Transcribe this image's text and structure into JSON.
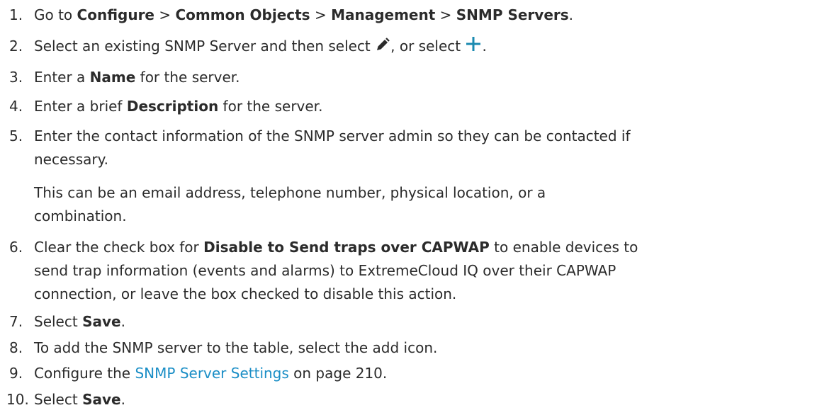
{
  "steps": [
    {
      "num": "1.",
      "parts": {
        "a": "Go to ",
        "b": "Configure",
        "c": " > ",
        "d": "Common Objects",
        "e": " > ",
        "f": "Management",
        "g": " > ",
        "h": "SNMP Servers",
        "i": "."
      }
    },
    {
      "num": "2.",
      "parts": {
        "a": "Select an existing SNMP Server and then select ",
        "b": ", or select ",
        "c": "."
      },
      "icons": {
        "edit": "pencil-icon",
        "add": "plus-icon",
        "add_color": "#1a8ab0"
      }
    },
    {
      "num": "3.",
      "parts": {
        "a": "Enter a ",
        "b": "Name",
        "c": " for the server."
      }
    },
    {
      "num": "4.",
      "parts": {
        "a": "Enter a brief ",
        "b": "Description",
        "c": " for the server."
      }
    },
    {
      "num": "5.",
      "lines": [
        "Enter the contact information of the SNMP server admin so they can be contacted if",
        "necessary."
      ],
      "note_lines": [
        "This can be an email address, telephone number, physical location, or a",
        "combination."
      ]
    },
    {
      "num": "6.",
      "parts": {
        "a": "Clear the check box for ",
        "b": "Disable to Send traps over CAPWAP",
        "c": " to enable devices to"
      },
      "lines": [
        "send trap information (events and alarms) to ExtremeCloud IQ over their CAPWAP",
        "connection, or leave the box checked to disable this action."
      ]
    },
    {
      "num": "7.",
      "parts": {
        "a": "Select ",
        "b": "Save",
        "c": "."
      }
    },
    {
      "num": "8.",
      "text": "To add the SNMP server to the table, select the add icon."
    },
    {
      "num": "9.",
      "parts": {
        "a": "Configure the ",
        "link": "SNMP Server Settings",
        "c": " on page 210."
      }
    },
    {
      "num": "10.",
      "parts": {
        "a": "Select ",
        "b": "Save",
        "c": "."
      }
    }
  ]
}
